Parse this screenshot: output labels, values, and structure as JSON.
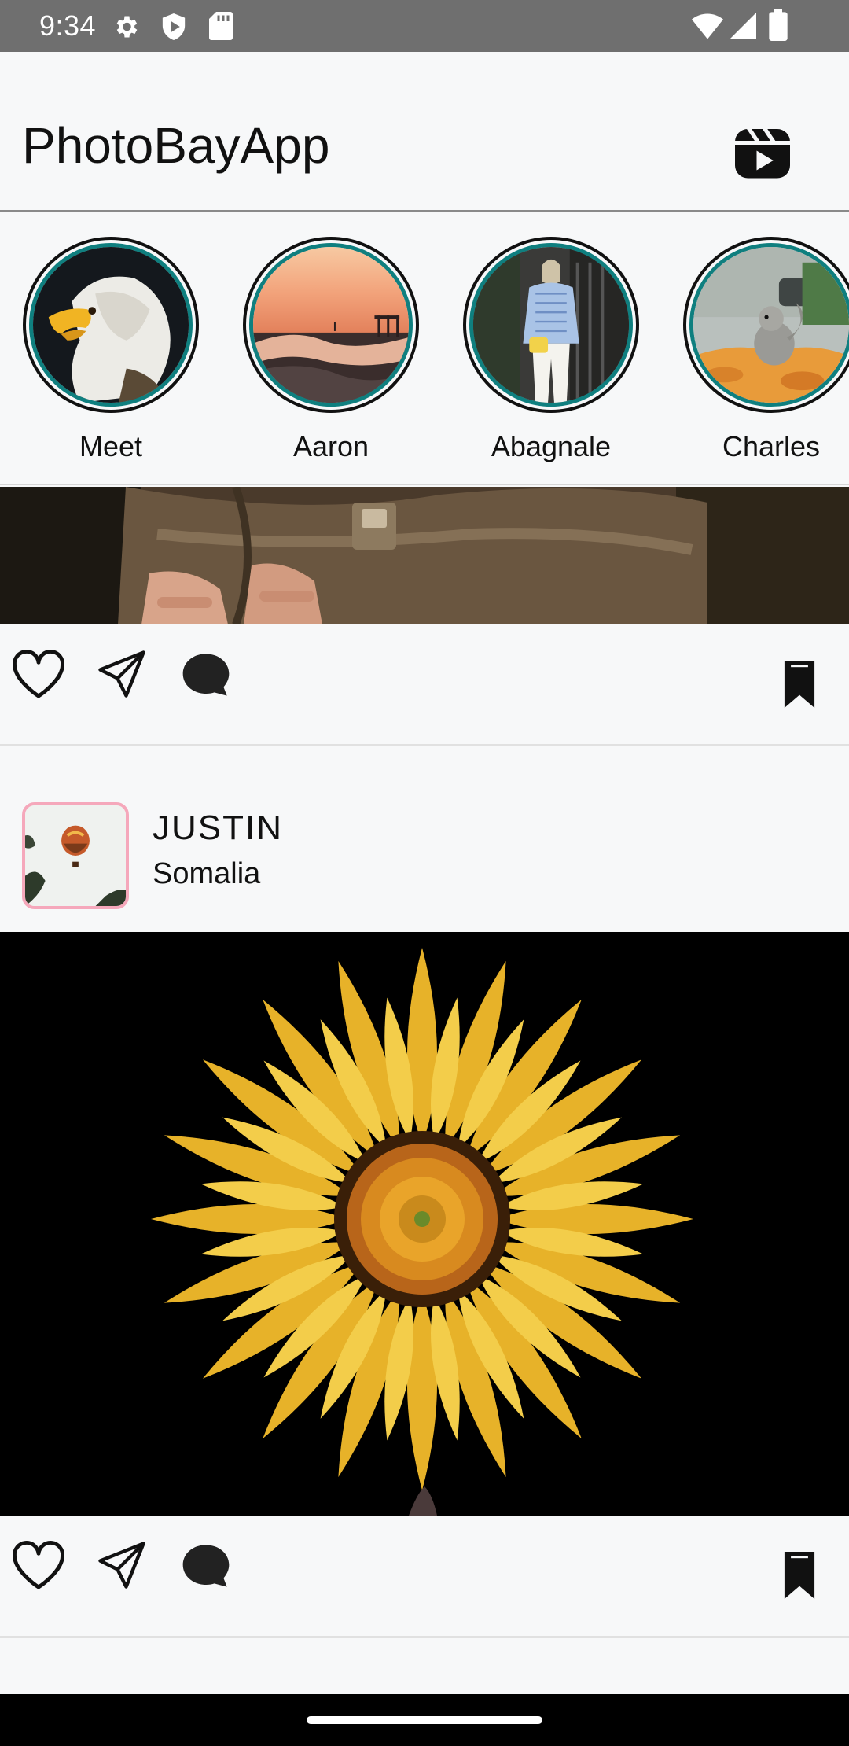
{
  "status_bar": {
    "time": "9:34",
    "icons": [
      "settings-icon",
      "play-protect-icon",
      "sd-card-icon",
      "wifi-icon",
      "signal-icon",
      "battery-icon"
    ]
  },
  "app_bar": {
    "title": "PhotoBayApp",
    "reels_icon": "reels-icon"
  },
  "stories": [
    {
      "name": "Meet"
    },
    {
      "name": "Aaron"
    },
    {
      "name": "Abagnale"
    },
    {
      "name": "Charles"
    }
  ],
  "posts": [
    {
      "actions": [
        "heart-icon",
        "send-icon",
        "comment-icon",
        "bookmark-icon"
      ]
    },
    {
      "user": "JUSTIN",
      "location": "Somalia",
      "actions": [
        "heart-icon",
        "send-icon",
        "comment-icon",
        "bookmark-icon"
      ]
    }
  ],
  "colors": {
    "story_ring": "#0f7f7f",
    "avatar_border": "#f5a8bb",
    "status_bar": "#6f6f6f",
    "background": "#f7f8f9"
  }
}
